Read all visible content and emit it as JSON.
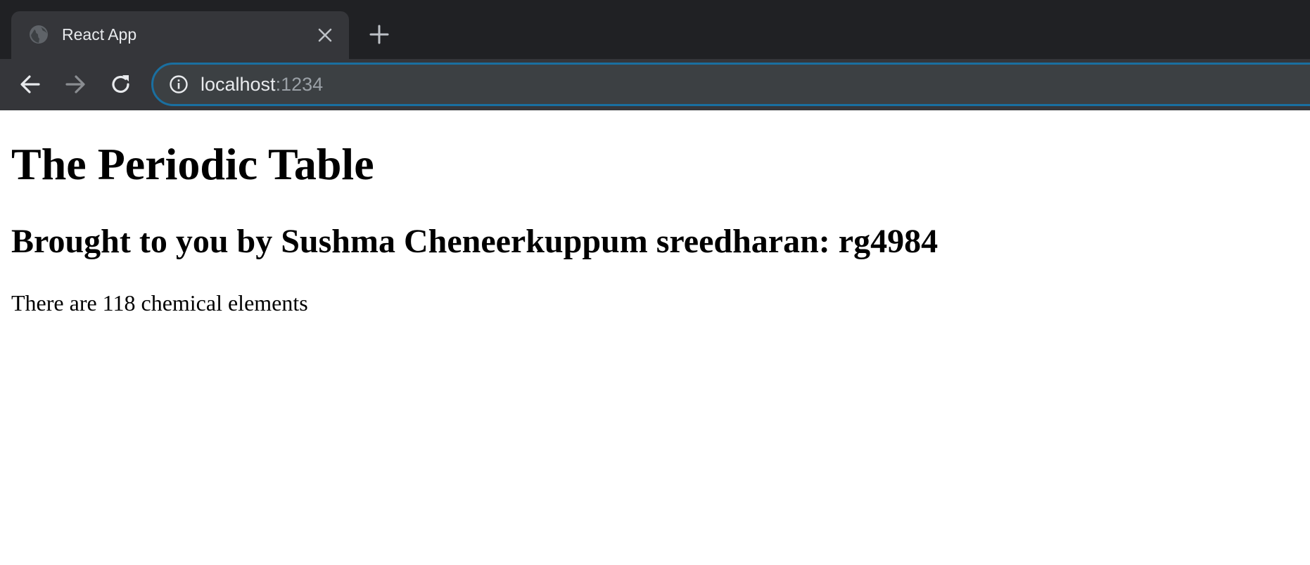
{
  "browser": {
    "tab": {
      "title": "React App",
      "favicon": "globe-icon"
    },
    "new_tab_icon": "plus-icon",
    "close_tab_icon": "close-icon",
    "nav": {
      "back_icon": "arrow-left-icon",
      "forward_icon": "arrow-right-icon",
      "reload_icon": "reload-icon"
    },
    "address_bar": {
      "security_icon": "info-icon",
      "host": "localhost",
      "port": ":1234"
    },
    "colors": {
      "frame": "#202124",
      "toolbar": "#35363a",
      "omnibox": "#3c4043",
      "omnibox_focus_ring": "#1a6fa0",
      "text": "#e8eaed",
      "text_muted": "#9aa0a6"
    }
  },
  "page": {
    "title": "The Periodic Table",
    "subtitle": "Brought to you by Sushma Cheneerkuppum sreedharan: rg4984",
    "description": "There are 118 chemical elements"
  }
}
